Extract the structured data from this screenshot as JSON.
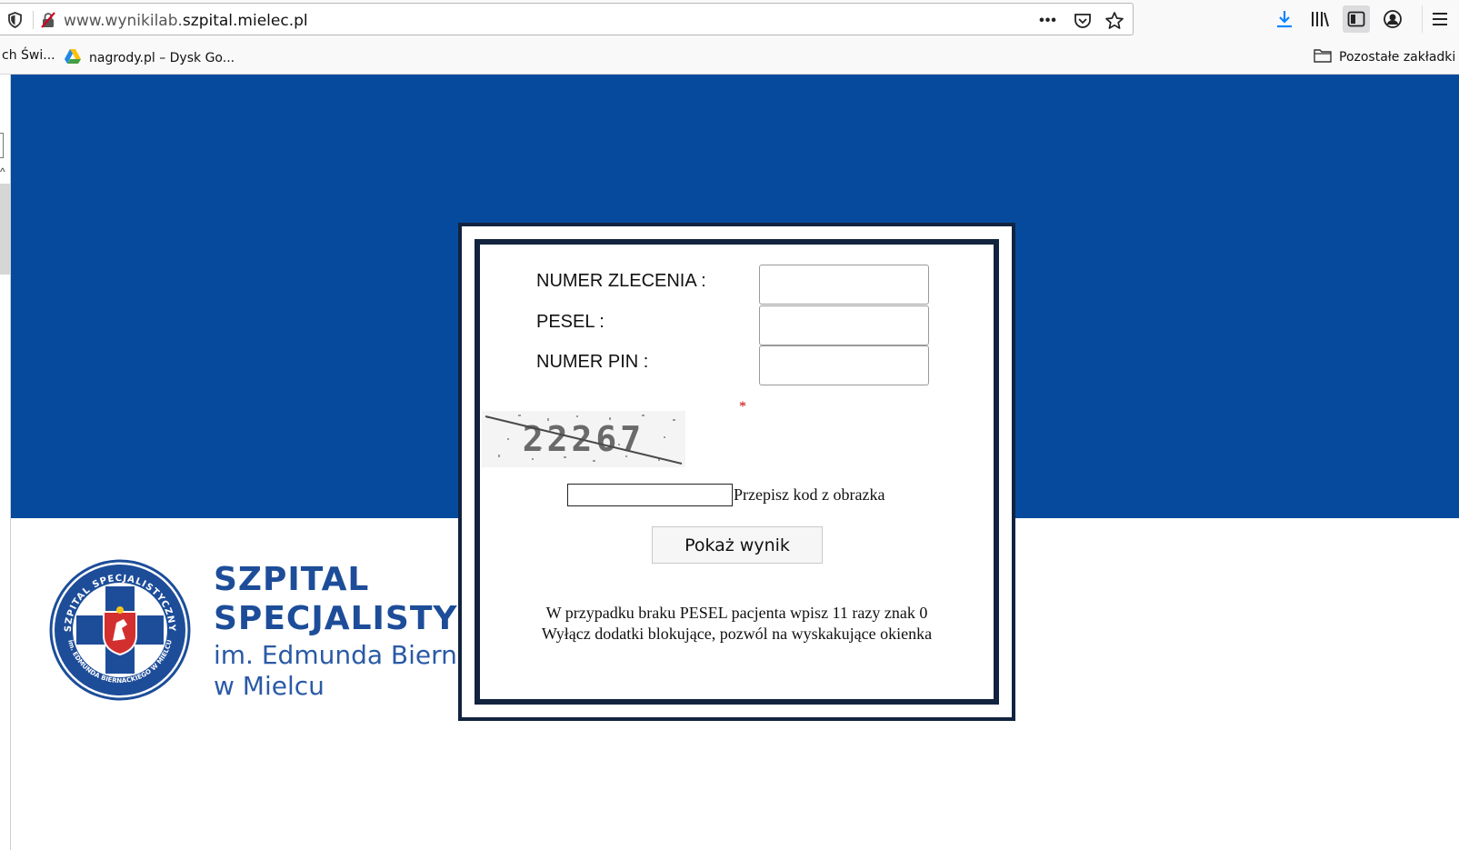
{
  "browser": {
    "url_prefix": "www.wynikilab.",
    "url_domain": "szpital.mielec.pl",
    "more_icon": "•••",
    "icons": {
      "shield": "shield-icon",
      "insecure": "insecure-connection-icon",
      "pocket": "pocket-icon",
      "bookmark_star": "bookmark-star-icon",
      "download": "download-icon",
      "library": "library-icon",
      "sidebar": "sidebar-icon",
      "account": "account-icon",
      "menu": "hamburger-menu-icon"
    }
  },
  "bookmarks": {
    "items": [
      {
        "label": "ch Świ..."
      },
      {
        "label": "nagrody.pl – Dysk Go..."
      }
    ],
    "other_bookmarks": "Pozostałe zakładki"
  },
  "page": {
    "colors": {
      "hero": "#064a9d",
      "dialog_border": "#12233f",
      "logo_text": "#1d4d99"
    },
    "logo": {
      "line1": "SZPITAL",
      "line2": "SPECJALISTY",
      "line3": "im. Edmunda Bierna",
      "line4": "w Mielcu",
      "emblem_top_text": "SZPITAL SPECJALISTYCZNY",
      "emblem_bottom_text": "im. EDMUNDA BIERNACKIEGO W MIELCU"
    }
  },
  "form": {
    "order_number_label": "NUMER ZLECENIA :",
    "order_number_value": "",
    "pesel_label": "PESEL :",
    "pesel_value": "",
    "pin_label": "NUMER PIN :",
    "pin_value": "",
    "required_marker": "*",
    "captcha_text": "22267",
    "captcha_input_value": "",
    "captcha_hint": "Przepisz kod z obrazka",
    "submit_label": "Pokaż wynik",
    "note_line1": "W przypadku braku PESEL pacjenta wpisz 11 razy znak 0",
    "note_line2": "Wyłącz dodatki blokujące, pozwól na wyskakujące okienka"
  }
}
